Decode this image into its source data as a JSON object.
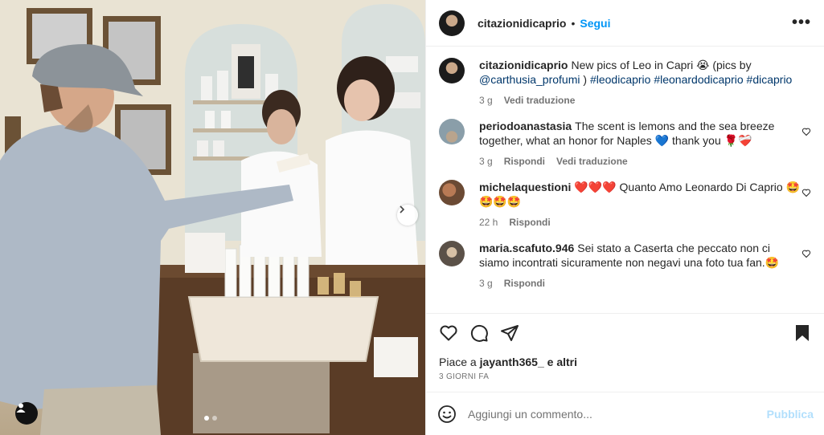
{
  "header": {
    "username": "citazionidicaprio",
    "bullet": "•",
    "follow_label": "Segui",
    "more_label": "•••"
  },
  "caption": {
    "username": "citazionidicaprio",
    "text": "New pics of Leo in Capri 😭 (pics by",
    "mention": "@carthusia_profumi",
    "after_mention": " ) ",
    "hashtags": "#leodicaprio #leonardodicaprio #dicaprio",
    "time": "3 g",
    "translate": "Vedi traduzione"
  },
  "comments": [
    {
      "username": "periodoanastasia",
      "text": "The scent is lemons and the sea breeze together, what an honor for Naples 💙 thank you 🌹❤️‍🩹",
      "time": "3 g",
      "reply": "Rispondi",
      "translate": "Vedi traduzione"
    },
    {
      "username": "michelaquestioni",
      "text": "❤️❤️❤️ Quanto Amo Leonardo Di Caprio 🤩🤩🤩🤩",
      "time": "22 h",
      "reply": "Rispondi"
    },
    {
      "username": "maria.scafuto.946",
      "text": "Sei stato a Caserta che peccato non ci siamo incontrati sicuramente non negavi una foto tua fan.🤩",
      "time": "3 g",
      "reply": "Rispondi"
    }
  ],
  "likes": {
    "prefix": "Piace a",
    "user": "jayanth365_",
    "suffix": "e altri"
  },
  "posted": "3 GIORNI FA",
  "composer": {
    "placeholder": "Aggiungi un commento...",
    "publish_label": "Pubblica"
  },
  "carousel": {
    "total": 2,
    "current": 1
  },
  "colors": {
    "accent": "#0095f6",
    "link": "#00376b",
    "muted": "#737373",
    "publish_disabled": "#b2dffc"
  }
}
